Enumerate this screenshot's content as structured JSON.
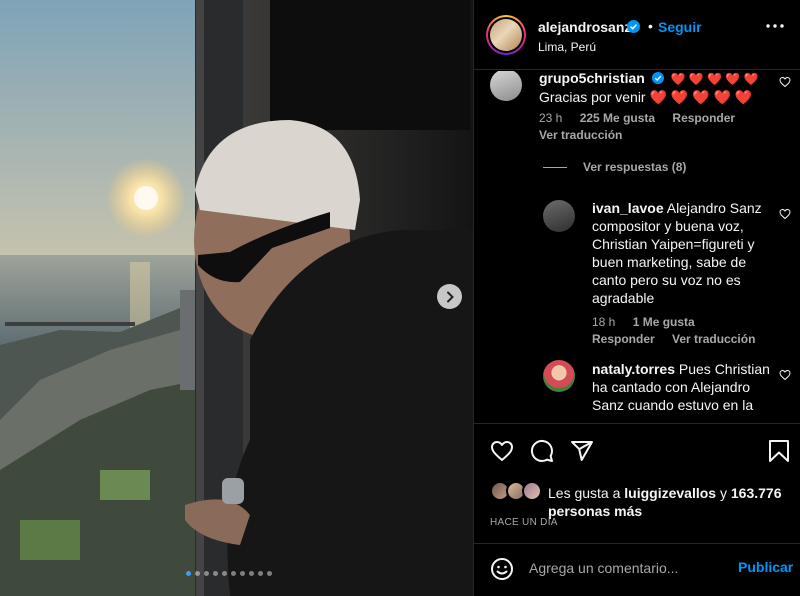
{
  "post": {
    "username": "alejandrosanz",
    "follow_label": "Seguir",
    "separator": "•",
    "location": "Lima, Perú",
    "carousel_total": 10,
    "carousel_active": 1
  },
  "comments": [
    {
      "username": "grupo5christian",
      "verified": true,
      "hearts": "❤️ ❤️ ❤️ ❤️ ❤️",
      "text_line2": "Gracias por venir ❤️ ❤️ ❤️ ❤️ ❤️",
      "time": "23 h",
      "likes": "225 Me gusta",
      "reply_label": "Responder",
      "translate_label": "Ver traducción",
      "replies_label": "Ver respuestas (8)"
    },
    {
      "username": "ivan_lavoe",
      "text": "Alejandro Sanz compositor y buena voz, Christian Yaipen=figureti y buen marketing, sabe de canto pero su voz no es agradable",
      "time": "18 h",
      "likes": "1 Me gusta",
      "reply_label": "Responder",
      "translate_label": "Ver traducción"
    },
    {
      "username": "nataly.torres",
      "text": "Pues Christian ha cantado con Alejandro Sanz cuando estuvo en la"
    }
  ],
  "likes_summary": {
    "prefix": "Les gusta a",
    "user": "luiggizevallos",
    "connector": "y",
    "count_text": "163.776 personas más"
  },
  "date_label": "HACE UN DÍA",
  "composer": {
    "placeholder": "Agrega un comentario...",
    "publish_label": "Publicar"
  },
  "colors": {
    "accent": "#0095f6",
    "muted": "#a8a8a8",
    "divider": "#262626",
    "heart": "#ff3040"
  },
  "icons": [
    "verified-icon",
    "more-options-icon",
    "heart-icon",
    "comment-icon",
    "share-icon",
    "bookmark-icon",
    "emoji-icon",
    "chevron-right-icon"
  ]
}
